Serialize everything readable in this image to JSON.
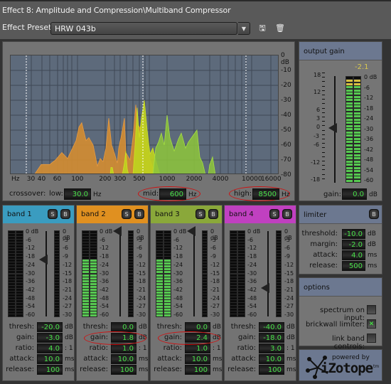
{
  "window": {
    "title": "Effect 8: Amplitude and Compression\\Multiband Compressor"
  },
  "preset": {
    "label": "Effect Preset:",
    "value": "HRW 043b",
    "save_icon": "save-icon",
    "delete_icon": "trash-icon"
  },
  "spectrum": {
    "y_labels": [
      "0 dB",
      "-10",
      "-20",
      "-30",
      "-40",
      "-50",
      "-60",
      "-70",
      "-80"
    ],
    "x_labels": [
      "Hz",
      "30",
      "40",
      "60",
      "100",
      "200",
      "300",
      "500",
      "1000",
      "2000",
      "4000",
      "10000",
      "16000"
    ],
    "crossover_markers_hz": [
      30,
      600,
      8500
    ],
    "colors": {
      "band1": "#1aa0d8",
      "band2": "#d89a3a",
      "band3": "#b8d81a",
      "band4": "#8ec83a",
      "background": "#5d6a7b"
    }
  },
  "crossover": {
    "label": "crossover:",
    "low": {
      "label": "low:",
      "value": "30.0",
      "unit": "Hz"
    },
    "mid": {
      "label": "mid:",
      "value": "600",
      "unit": "Hz"
    },
    "high": {
      "label": "high:",
      "value": "8500",
      "unit": "Hz"
    }
  },
  "output_gain": {
    "title": "output gain",
    "peak": "-2.1",
    "slider_scale": [
      "18",
      "12",
      "6",
      "3",
      "0",
      "-3",
      "-6",
      "-12",
      "-18"
    ],
    "meter_scale": [
      "0 dB",
      "-6",
      "-12",
      "-18",
      "-24",
      "-30",
      "-36",
      "-42",
      "-48",
      "-54",
      "-60"
    ],
    "gain_label": "gain:",
    "gain_value": "0.0",
    "gain_unit": "dB",
    "slider_value_db": 0,
    "meter_level_db": -2.1
  },
  "bands": [
    {
      "name": "band 1",
      "color": "#3a9cc0",
      "solo": "S",
      "bypass": "B",
      "thresh": "-20.0",
      "gain": "-3.0",
      "ratio": "4.0",
      "attack": "10.0",
      "release": "100",
      "slider_db": -20,
      "meter_db": -60,
      "gr_db": 0
    },
    {
      "name": "band 2",
      "color": "#e09020",
      "solo": "S",
      "bypass": "B",
      "thresh": "0.0",
      "gain": "1.8",
      "ratio": "1.0",
      "attack": "10.0",
      "release": "100",
      "slider_db": 0,
      "meter_db": -20,
      "gr_db": 0
    },
    {
      "name": "band 3",
      "color": "#8aa83a",
      "solo": "S",
      "bypass": "B",
      "thresh": "0.0",
      "gain": "2.4",
      "ratio": "1.0",
      "attack": "10.0",
      "release": "100",
      "slider_db": 0,
      "meter_db": -20,
      "gr_db": 0
    },
    {
      "name": "band 4",
      "color": "#c040c0",
      "solo": "S",
      "bypass": "B",
      "thresh": "-40.0",
      "gain": "-18.0",
      "ratio": "3.0",
      "attack": "10.0",
      "release": "100",
      "slider_db": -40,
      "meter_db": -60,
      "gr_db": 0
    }
  ],
  "band_labels": {
    "thresh": "thresh:",
    "gain": "gain:",
    "ratio": "ratio:",
    "attack": "attack:",
    "release": "release:",
    "db": "dB",
    "ratio_unit": ": 1",
    "ms": "ms"
  },
  "band_meter_scale": [
    "0 dB",
    "-6",
    "-12",
    "-18",
    "-24",
    "-30",
    "-36",
    "-42",
    "-48",
    "-54",
    "-60"
  ],
  "band_gr_scale": [
    "0 dB",
    "-3",
    "-6",
    "-9",
    "-12",
    "-15",
    "-18",
    "-21",
    "-24",
    "-27",
    "-30"
  ],
  "limiter": {
    "title": "limiter",
    "bypass": "B",
    "threshold": {
      "label": "threshold:",
      "value": "-10.0",
      "unit": "dB"
    },
    "margin": {
      "label": "margin:",
      "value": "-2.0",
      "unit": "dB"
    },
    "attack": {
      "label": "attack:",
      "value": "4.0",
      "unit": "ms"
    },
    "release": {
      "label": "release:",
      "value": "500",
      "unit": "ms"
    }
  },
  "options": {
    "title": "options",
    "items": [
      {
        "label": "spectrum on input:",
        "checked": false
      },
      {
        "label": "brickwall limiter:",
        "checked": true
      },
      {
        "label": "link band controls:",
        "checked": false
      }
    ]
  },
  "logo": {
    "powered_by": "powered by",
    "brand": "iZotope",
    "tm": "tm"
  }
}
